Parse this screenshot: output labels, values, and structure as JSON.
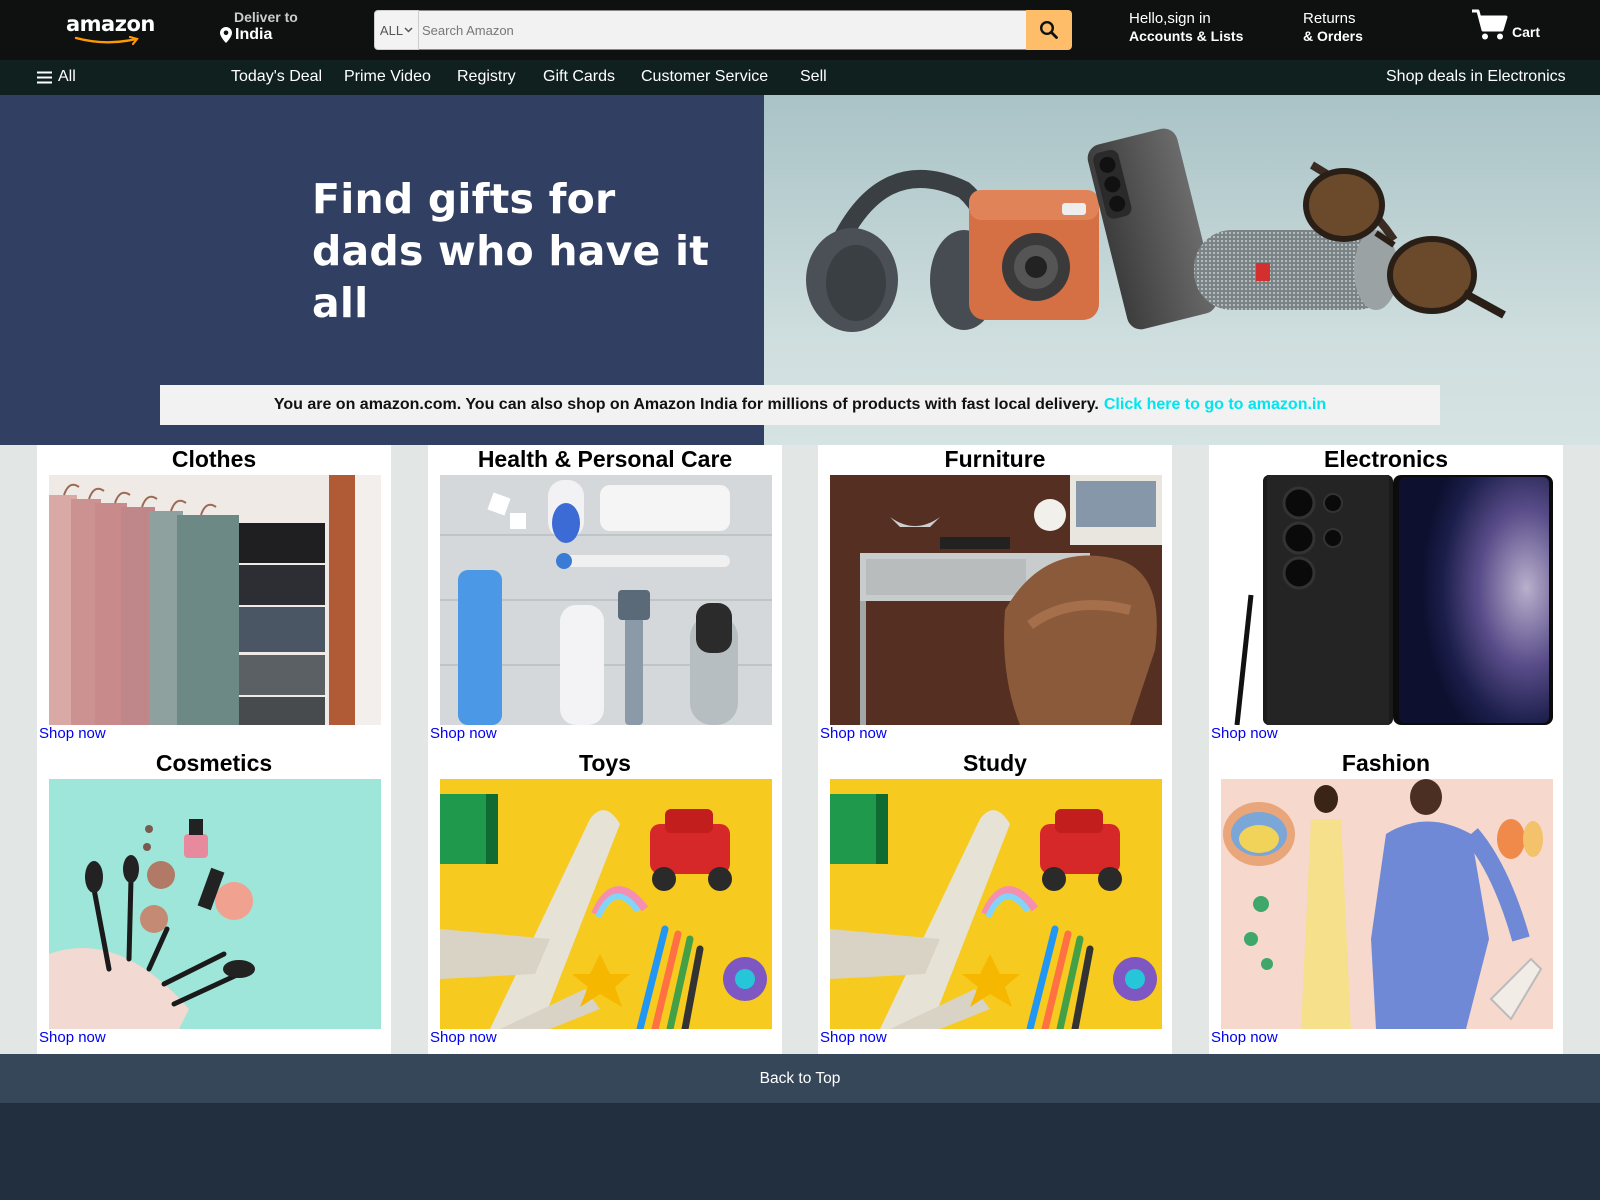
{
  "header": {
    "logo": "amazon",
    "deliver_label": "Deliver to",
    "deliver_location": "India",
    "search": {
      "category": "ALL",
      "placeholder": "Search Amazon"
    },
    "account_greeting": "Hello,sign in",
    "account_lists": "Accounts & Lists",
    "returns": "Returns",
    "orders": "& Orders",
    "cart": "Cart"
  },
  "subnav": {
    "all": "All",
    "items": [
      "Today's Deal",
      "Prime Video",
      "Registry",
      "Gift Cards",
      "Customer Service",
      "Sell"
    ],
    "right": "Shop deals in Electronics"
  },
  "hero": {
    "title_line1": "Find gifts for",
    "title_line2": "dads who have it all",
    "notice": "You are on amazon.com. You can also shop on Amazon India for millions of products with fast local delivery.",
    "notice_link": "Click here to go to amazon.in"
  },
  "categories": [
    {
      "title": "Clothes",
      "link": "Shop now"
    },
    {
      "title": "Health & Personal Care",
      "link": "Shop now"
    },
    {
      "title": "Furniture",
      "link": "Shop now"
    },
    {
      "title": "Electronics",
      "link": "Shop now"
    },
    {
      "title": "Cosmetics",
      "link": "Shop now"
    },
    {
      "title": "Toys",
      "link": "Shop now"
    },
    {
      "title": "Study",
      "link": "Shop now"
    },
    {
      "title": "Fashion",
      "link": "Shop now"
    }
  ],
  "footer": {
    "back_to_top": "Back to Top"
  },
  "colors": {
    "nav": "#0f1111",
    "subnav": "#10201f",
    "hero_left": "#313f63",
    "search_button": "#febd69",
    "notice_link": "#00e5ef",
    "back_to_top": "#37475a",
    "footer": "#222f3e"
  }
}
